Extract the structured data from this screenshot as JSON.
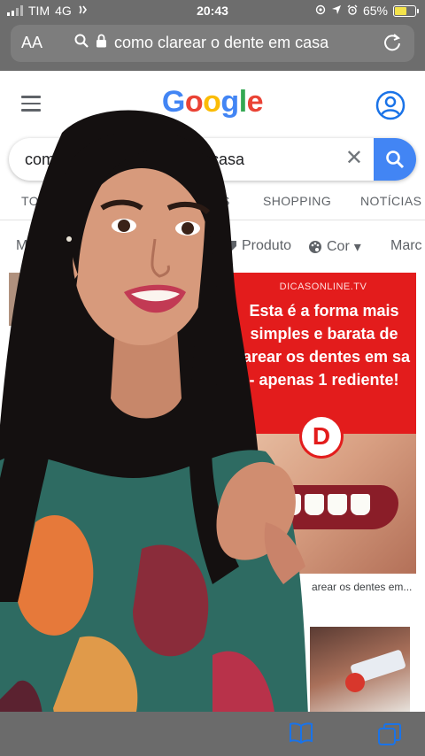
{
  "status_bar": {
    "carrier": "TIM",
    "network": "4G",
    "time": "20:43",
    "battery": "65%",
    "battery_level": 0.65,
    "icons": [
      "signal-icon",
      "wifi-calling-icon",
      "location-icon",
      "alarm-icon",
      "battery-icon"
    ]
  },
  "address_bar": {
    "text_size_label": "AA",
    "url_text": "como clarear o dente em casa",
    "icons": [
      "search-icon",
      "lock-icon",
      "reload-icon"
    ]
  },
  "google": {
    "logo": "Google",
    "logo_colors": [
      "#4285F4",
      "#EA4335",
      "#FBBC05",
      "#4285F4",
      "#34A853",
      "#EA4335"
    ],
    "search_value_start": "como",
    "search_value_end": "casa",
    "tabs": [
      "TODA",
      "S",
      "SHOPPING",
      "NOTÍCIAS"
    ],
    "chips": [
      "Ma",
      "Produto",
      "Cor",
      "Marc"
    ],
    "accent": "#4285F4"
  },
  "results": {
    "ad_site": "DICASONLINE.TV",
    "ad_headline": "Esta é a forma mais simples e barata de larear os dentes em sa - apenas 1 rediente!",
    "ad_logo_letter": "D",
    "caption": "arear os dentes em..."
  },
  "toolbar": {
    "icons": [
      "bookmarks-icon",
      "tabs-icon"
    ]
  }
}
